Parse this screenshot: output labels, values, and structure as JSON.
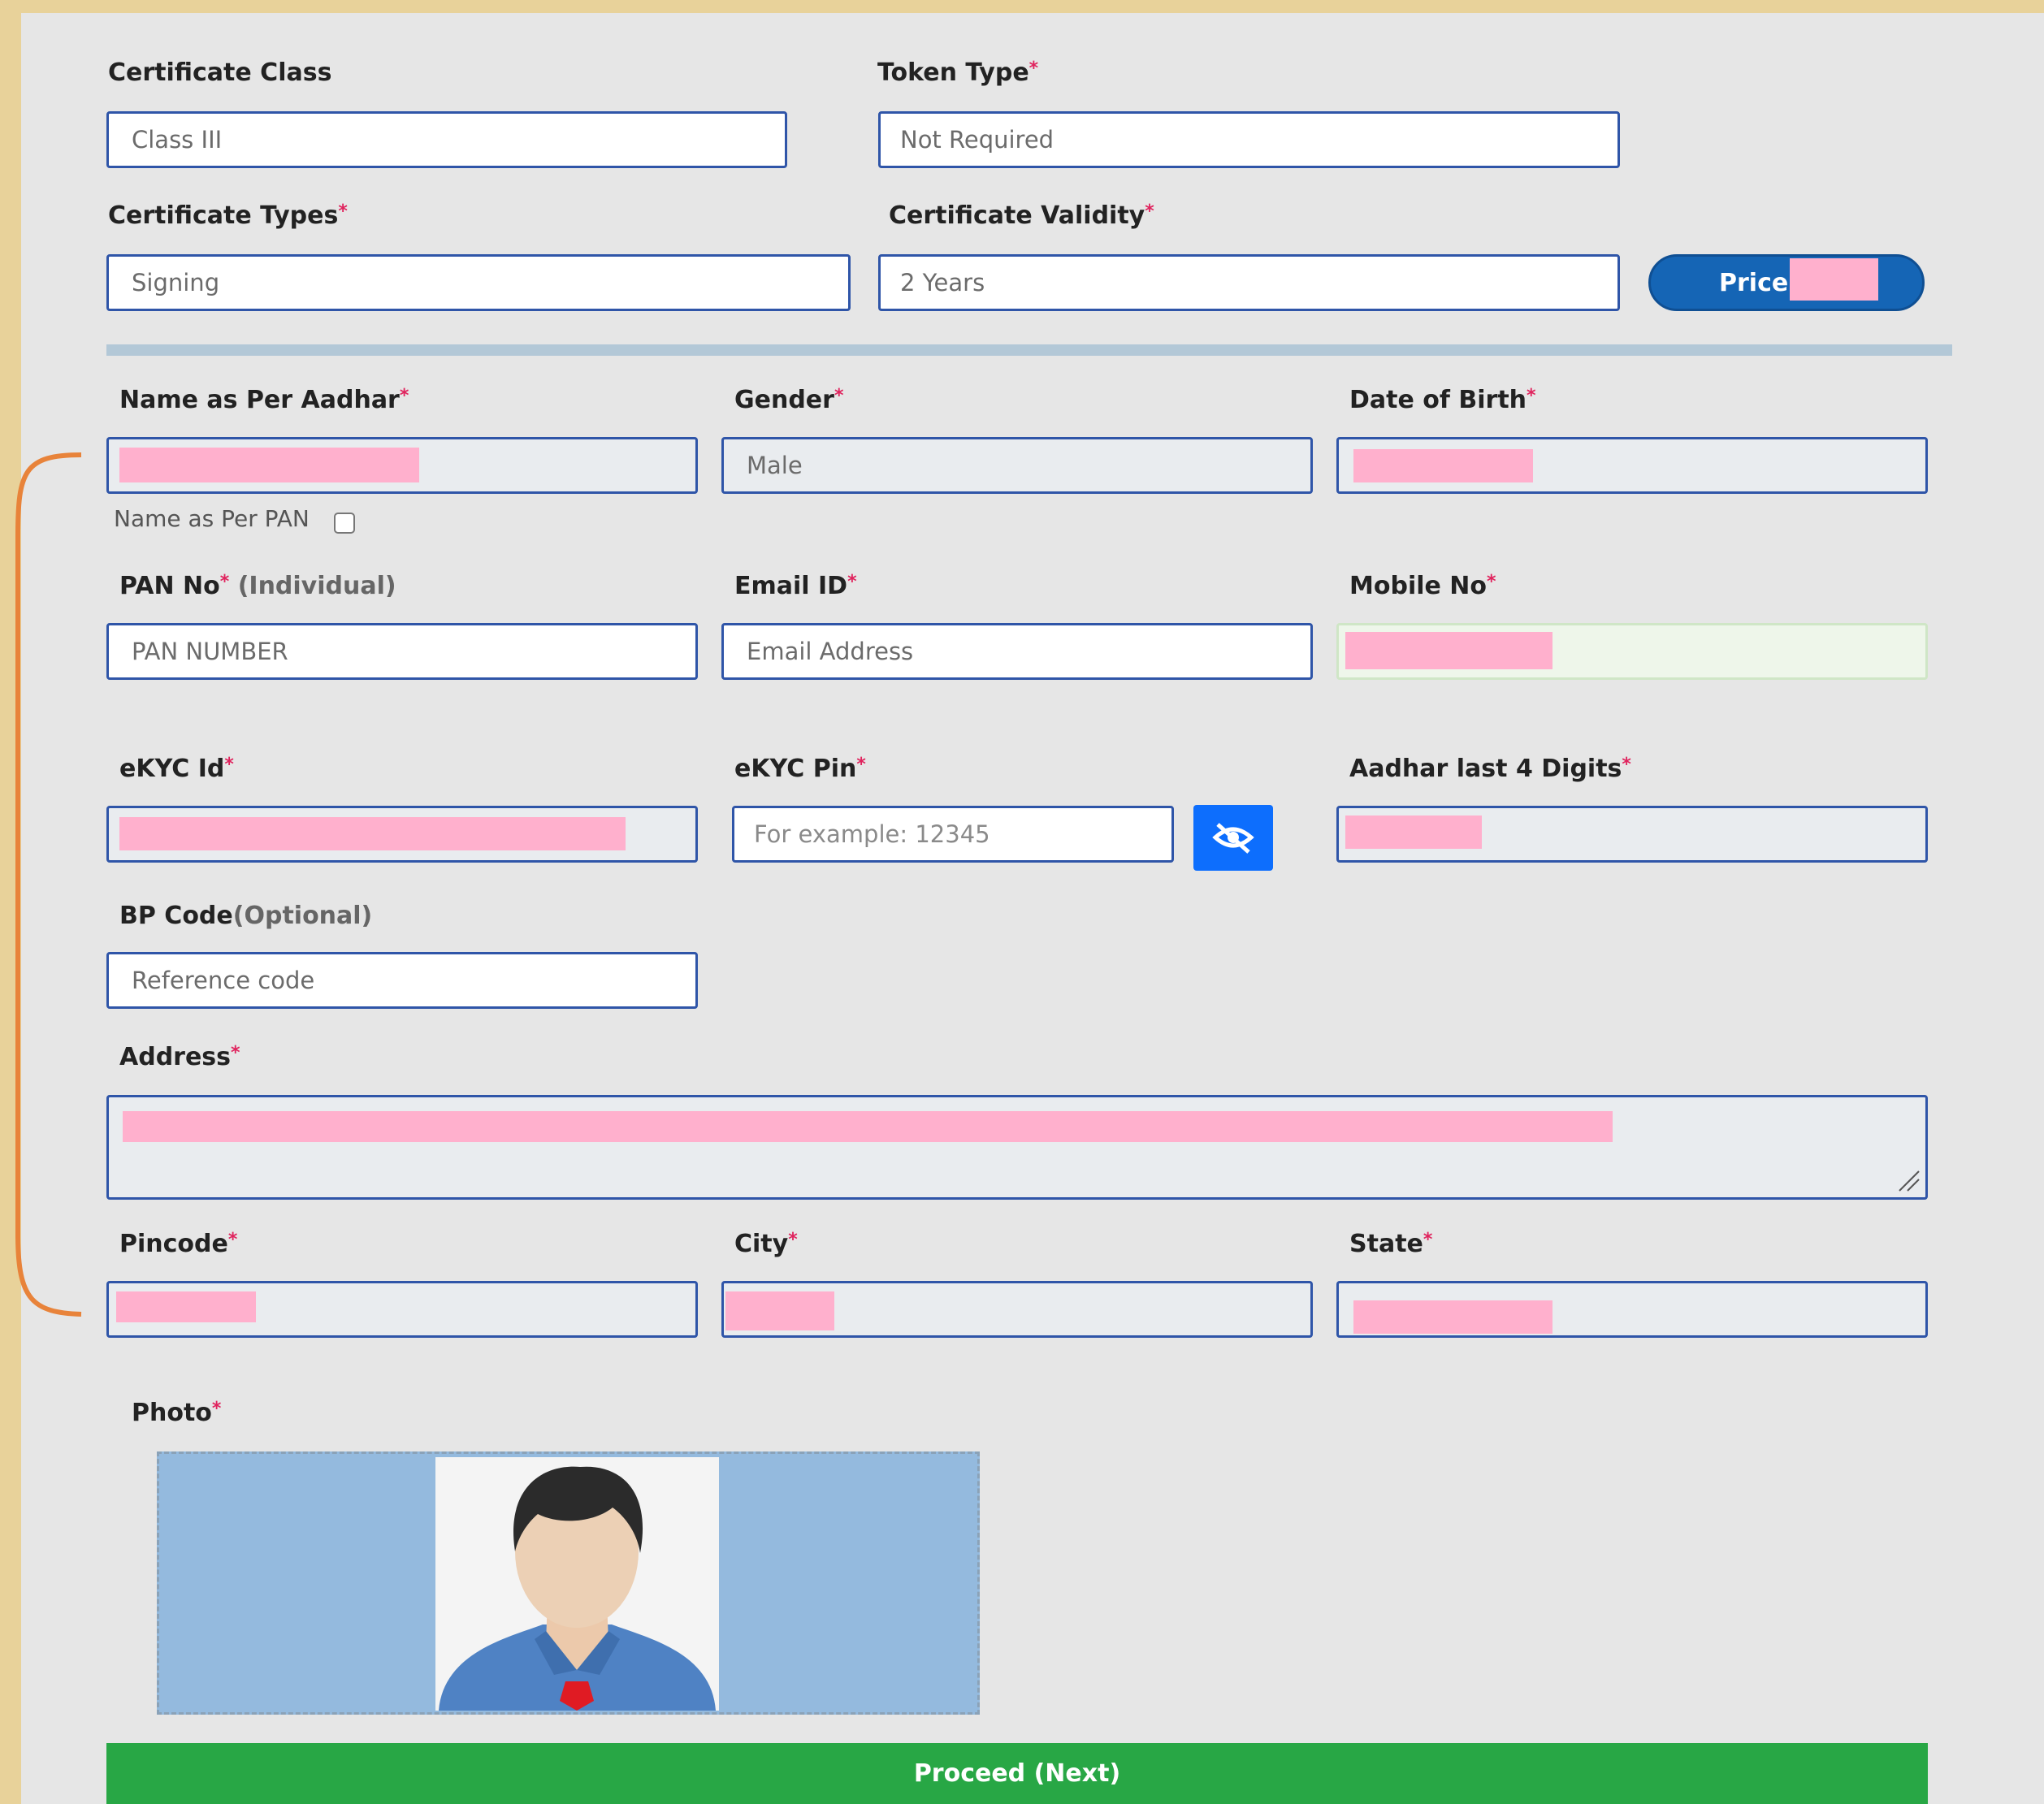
{
  "header": {
    "certificate_class": {
      "label": "Certificate Class",
      "value": "Class III"
    },
    "token_type": {
      "label": "Token Type",
      "value": "Not Required"
    },
    "certificate_types": {
      "label": "Certificate Types",
      "value": "Signing"
    },
    "certificate_validity": {
      "label": "Certificate Validity",
      "value": "2 Years"
    },
    "price_label": "Price:"
  },
  "required_marker": "*",
  "personal": {
    "name_aadhar": {
      "label": "Name as Per Aadhar"
    },
    "name_as_pan": "Name as Per PAN",
    "gender": {
      "label": "Gender",
      "value": "Male"
    },
    "dob": {
      "label": "Date of Birth"
    },
    "pan": {
      "label": "PAN No",
      "qualifier": " (Individual)",
      "placeholder": "PAN NUMBER"
    },
    "email": {
      "label": "Email ID",
      "placeholder": "Email Address"
    },
    "mobile": {
      "label": "Mobile No"
    },
    "ekyc_id": {
      "label": "eKYC Id"
    },
    "ekyc_pin": {
      "label": "eKYC Pin",
      "placeholder": "For example: 12345"
    },
    "aadhar_last4": {
      "label": "Aadhar last 4 Digits"
    },
    "bp_code": {
      "label": "BP Code",
      "qualifier": "(Optional)",
      "placeholder": "Reference code"
    },
    "address": {
      "label": "Address"
    },
    "pincode": {
      "label": "Pincode"
    },
    "city": {
      "label": "City"
    },
    "state": {
      "label": "State"
    },
    "photo": {
      "label": "Photo"
    }
  },
  "actions": {
    "proceed_label": "Proceed (Next)"
  },
  "colors": {
    "redaction": "#ffb0cd",
    "primary": "#0d6efd",
    "success": "#28a745",
    "annotation": "#e8833a"
  },
  "icons": {
    "toggle_visibility": "eye-slash-icon"
  }
}
